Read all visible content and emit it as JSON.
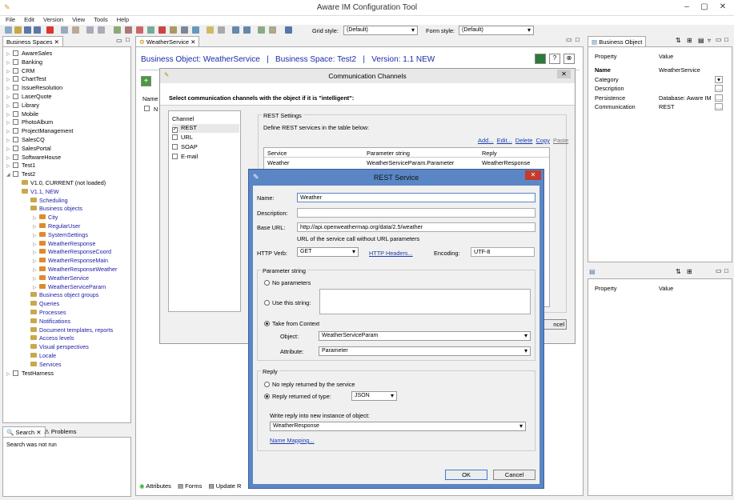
{
  "window": {
    "title": "Aware IM Configuration Tool"
  },
  "menu": [
    "File",
    "Edit",
    "Version",
    "View",
    "Tools",
    "Help"
  ],
  "toolbar": {
    "grid_style_label": "Grid style:",
    "grid_style_value": "(Default)",
    "form_style_label": "Form style:",
    "form_style_value": "(Default)"
  },
  "left_panel": {
    "tab_label": "Business Spaces",
    "tree": [
      {
        "label": "AwareSales",
        "level": 0
      },
      {
        "label": "Banking",
        "level": 0
      },
      {
        "label": "CRM",
        "level": 0
      },
      {
        "label": "ChartTest",
        "level": 0
      },
      {
        "label": "IssueResolution",
        "level": 0
      },
      {
        "label": "LaserQuote",
        "level": 0
      },
      {
        "label": "Library",
        "level": 0
      },
      {
        "label": "Mobile",
        "level": 0
      },
      {
        "label": "PhotoAlbum",
        "level": 0
      },
      {
        "label": "ProjectManagement",
        "level": 0
      },
      {
        "label": "SalesCQ",
        "level": 0
      },
      {
        "label": "SalesPortal",
        "level": 0
      },
      {
        "label": "SoftwareHouse",
        "level": 0
      },
      {
        "label": "Test1",
        "level": 0
      },
      {
        "label": "Test2",
        "level": 0
      },
      {
        "label": "V1.0, CURRENT (not loaded)",
        "level": 1
      },
      {
        "label": "V1.1, NEW",
        "level": 1
      },
      {
        "label": "Scheduling",
        "level": 2
      },
      {
        "label": "Business objects",
        "level": 2
      },
      {
        "label": "City",
        "level": 3
      },
      {
        "label": "RegularUser",
        "level": 3
      },
      {
        "label": "SystemSettings",
        "level": 3
      },
      {
        "label": "WeatherResponse",
        "level": 3
      },
      {
        "label": "WeatherResponseCoord",
        "level": 3
      },
      {
        "label": "WeatherResponseMain",
        "level": 3
      },
      {
        "label": "WeatherResponseWeather",
        "level": 3
      },
      {
        "label": "WeatherService",
        "level": 3
      },
      {
        "label": "WeatherServiceParam",
        "level": 3
      },
      {
        "label": "Business object groups",
        "level": 2
      },
      {
        "label": "Queries",
        "level": 2
      },
      {
        "label": "Processes",
        "level": 2
      },
      {
        "label": "Notifications",
        "level": 2
      },
      {
        "label": "Document templates, reports",
        "level": 2
      },
      {
        "label": "Access levels",
        "level": 2
      },
      {
        "label": "Visual perspectives",
        "level": 2
      },
      {
        "label": "Locale",
        "level": 2
      },
      {
        "label": "Services",
        "level": 2
      },
      {
        "label": "TestHarness",
        "level": 0
      }
    ],
    "search_tab": "Search",
    "problems_tab": "Problems",
    "search_status": "Search was not run"
  },
  "editor": {
    "tab_label": "WeatherService",
    "header": "Business Object: WeatherService   |   Business Space: Test2   |   Version: 1.1 NEW",
    "name_col": "Name",
    "bottom_tabs": [
      "Attributes",
      "Forms",
      "Update R"
    ]
  },
  "right_panel": {
    "tab_label": "Business Object",
    "col_property": "Property",
    "col_value": "Value",
    "rows": [
      {
        "property": "Name",
        "value": "WeatherService"
      },
      {
        "property": "Category",
        "value": ""
      },
      {
        "property": "Description",
        "value": ""
      },
      {
        "property": "Persistence",
        "value": "Database: Aware IM"
      },
      {
        "property": "Communication",
        "value": "REST"
      }
    ],
    "bottom_col_property": "Property",
    "bottom_col_value": "Value"
  },
  "comm_dialog": {
    "title": "Communication Channels",
    "instruction": "Select communication channels with the object if it is \"intelligent\":",
    "channel_header": "Channel",
    "channels": [
      {
        "label": "REST",
        "checked": true
      },
      {
        "label": "URL",
        "checked": false
      },
      {
        "label": "SOAP",
        "checked": false
      },
      {
        "label": "E-mail",
        "checked": false
      }
    ],
    "rest_settings": "REST Settings",
    "define_text": "Define REST services in the table below:",
    "links": [
      "Add...",
      "Edit...",
      "Delete",
      "Copy",
      "Paste"
    ],
    "table_headers": [
      "Service",
      "Parameter string",
      "Reply"
    ],
    "table_row": [
      "Weather",
      "WeatherServiceParam.Parameter",
      "WeatherResponse"
    ],
    "cancel_partial": "ncel"
  },
  "rest_dialog": {
    "title": "REST Service",
    "name_label": "Name:",
    "name_value": "Weather",
    "description_label": "Description:",
    "description_value": "",
    "base_url_label": "Base URL:",
    "base_url_value": "http://api.openweathermap.org/data/2.5/weather",
    "url_hint": "URL of the service call without URL parameters",
    "http_verb_label": "HTTP Verb:",
    "http_verb_value": "GET",
    "http_headers_link": "HTTP Headers...",
    "encoding_label": "Encoding:",
    "encoding_value": "UTF-8",
    "param_group": "Parameter string",
    "no_params": "No parameters",
    "use_string": "Use this string:",
    "from_context": "Take from Context",
    "object_label": "Object:",
    "object_value": "WeatherServiceParam",
    "attribute_label": "Attribute:",
    "attribute_value": "Parameter",
    "reply_group": "Reply",
    "no_reply": "No reply returned by the service",
    "reply_type": "Reply returned of type:",
    "reply_type_value": "JSON",
    "write_reply": "Write reply into new instance of object:",
    "reply_object_value": "WeatherResponse",
    "name_mapping_link": "Name Mapping...",
    "ok_label": "OK",
    "cancel_label": "Cancel"
  }
}
